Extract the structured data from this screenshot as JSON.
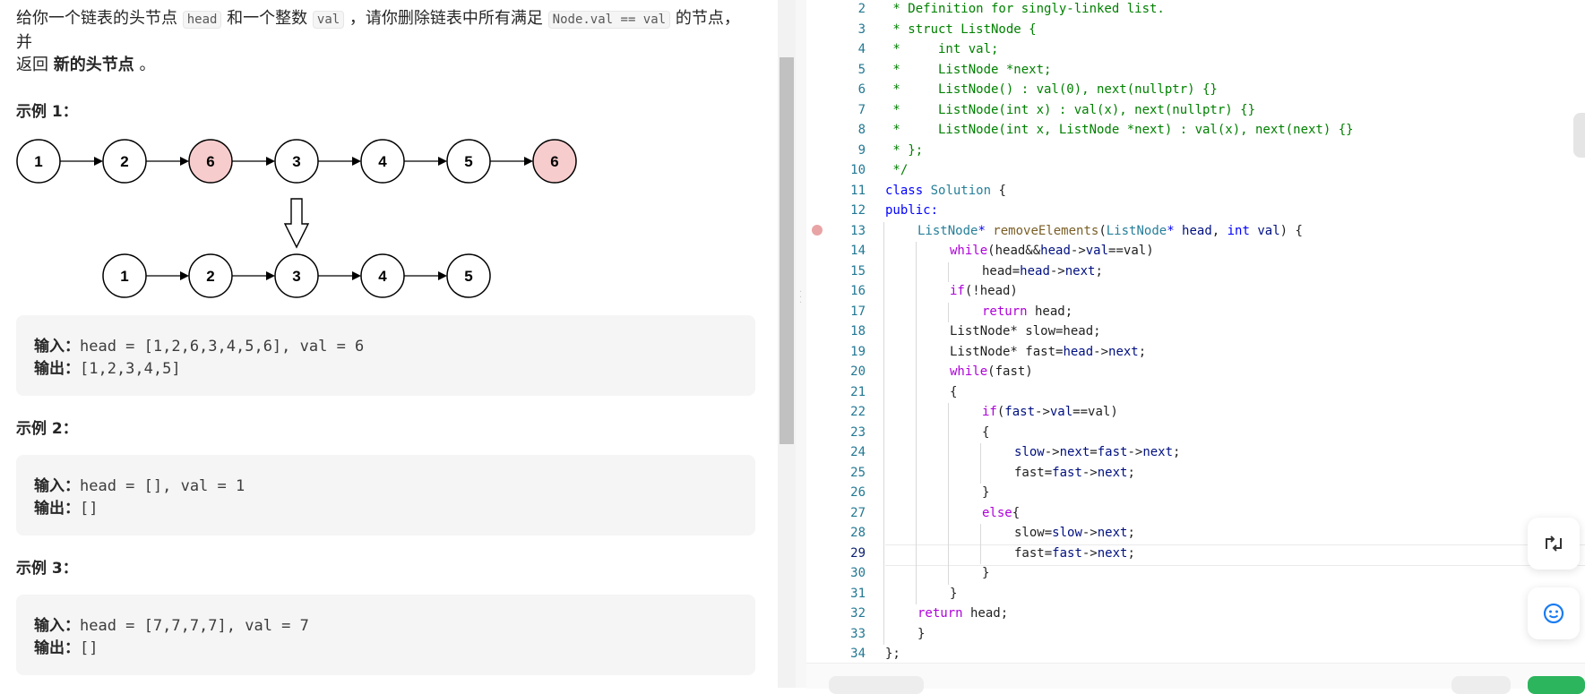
{
  "description": {
    "p1": "给你一个链表的头节点 ",
    "c1": "head",
    "p2": " 和一个整数 ",
    "c2": "val",
    "p3": " ，请你删除链表中所有满足 ",
    "c3": "Node.val == val",
    "p4": " 的节点，并",
    "p5": "返回 ",
    "p6": "新的头节点",
    "p7": " 。"
  },
  "diagram": {
    "top_nodes": [
      "1",
      "2",
      "6",
      "3",
      "4",
      "5",
      "6"
    ],
    "top_removed": [
      false,
      false,
      true,
      false,
      false,
      false,
      true
    ],
    "bottom_nodes": [
      "1",
      "2",
      "3",
      "4",
      "5"
    ]
  },
  "examples": [
    {
      "title": "示例 1：",
      "input_label": "输入：",
      "input": "head = [1,2,6,3,4,5,6], val = 6",
      "output_label": "输出：",
      "output": "[1,2,3,4,5]"
    },
    {
      "title": "示例 2：",
      "input_label": "输入：",
      "input": "head = [], val = 1",
      "output_label": "输出：",
      "output": "[]"
    },
    {
      "title": "示例 3：",
      "input_label": "输入：",
      "input": "head = [7,7,7,7], val = 7",
      "output_label": "输出：",
      "output": "[]"
    }
  ],
  "editor": {
    "lines": [
      {
        "n": "2",
        "indent": 0,
        "tokens": [
          [
            " * Definition for singly-linked list.",
            "cm"
          ]
        ]
      },
      {
        "n": "3",
        "indent": 0,
        "tokens": [
          [
            " * struct ListNode {",
            "cm"
          ]
        ]
      },
      {
        "n": "4",
        "indent": 0,
        "tokens": [
          [
            " *     int val;",
            "cm"
          ]
        ]
      },
      {
        "n": "5",
        "indent": 0,
        "tokens": [
          [
            " *     ListNode *next;",
            "cm"
          ]
        ]
      },
      {
        "n": "6",
        "indent": 0,
        "tokens": [
          [
            " *     ListNode() : val(0), next(nullptr) {}",
            "cm"
          ]
        ]
      },
      {
        "n": "7",
        "indent": 0,
        "tokens": [
          [
            " *     ListNode(int x) : val(x), next(nullptr) {}",
            "cm"
          ]
        ]
      },
      {
        "n": "8",
        "indent": 0,
        "tokens": [
          [
            " *     ListNode(int x, ListNode *next) : val(x), next(next) {}",
            "cm"
          ]
        ]
      },
      {
        "n": "9",
        "indent": 0,
        "tokens": [
          [
            " * };",
            "cm"
          ]
        ]
      },
      {
        "n": "10",
        "indent": 0,
        "tokens": [
          [
            " */",
            "cm"
          ]
        ]
      },
      {
        "n": "11",
        "indent": 0,
        "tokens": [
          [
            "class",
            "kw"
          ],
          [
            " ",
            ""
          ],
          [
            "Solution",
            "ty"
          ],
          [
            " {",
            ""
          ]
        ]
      },
      {
        "n": "12",
        "indent": 0,
        "tokens": [
          [
            "public:",
            "kw"
          ]
        ]
      },
      {
        "n": "13",
        "indent": 1,
        "tokens": [
          [
            "ListNode",
            "ty"
          ],
          [
            "* ",
            "kw"
          ],
          [
            "removeElements",
            "fn"
          ],
          [
            "(",
            ""
          ],
          [
            "ListNode",
            "ty"
          ],
          [
            "* ",
            "kw"
          ],
          [
            "head",
            "var"
          ],
          [
            ", ",
            ""
          ],
          [
            "int",
            "kw"
          ],
          [
            " ",
            ""
          ],
          [
            "val",
            "var"
          ],
          [
            ") {",
            ""
          ]
        ]
      },
      {
        "n": "14",
        "indent": 2,
        "tokens": [
          [
            "while",
            "ctl"
          ],
          [
            "(head&&",
            ""
          ],
          [
            "head",
            "var"
          ],
          [
            "->",
            ""
          ],
          [
            "val",
            "var"
          ],
          [
            "==val)",
            ""
          ]
        ]
      },
      {
        "n": "15",
        "indent": 3,
        "tokens": [
          [
            "head=",
            ""
          ],
          [
            "head",
            "var"
          ],
          [
            "->",
            ""
          ],
          [
            "next",
            "var"
          ],
          [
            ";",
            ""
          ]
        ]
      },
      {
        "n": "16",
        "indent": 2,
        "tokens": [
          [
            "if",
            "ctl"
          ],
          [
            "(!head)",
            ""
          ]
        ]
      },
      {
        "n": "17",
        "indent": 3,
        "tokens": [
          [
            "return",
            "ctl"
          ],
          [
            " head;",
            ""
          ]
        ]
      },
      {
        "n": "18",
        "indent": 2,
        "tokens": [
          [
            "ListNode* slow=head;",
            ""
          ]
        ]
      },
      {
        "n": "19",
        "indent": 2,
        "tokens": [
          [
            "ListNode* fast=",
            ""
          ],
          [
            "head",
            "var"
          ],
          [
            "->",
            ""
          ],
          [
            "next",
            "var"
          ],
          [
            ";",
            ""
          ]
        ]
      },
      {
        "n": "20",
        "indent": 2,
        "tokens": [
          [
            "while",
            "ctl"
          ],
          [
            "(fast)",
            ""
          ]
        ]
      },
      {
        "n": "21",
        "indent": 2,
        "tokens": [
          [
            "{",
            ""
          ]
        ]
      },
      {
        "n": "22",
        "indent": 3,
        "tokens": [
          [
            "if",
            "ctl"
          ],
          [
            "(",
            ""
          ],
          [
            "fast",
            "var"
          ],
          [
            "->",
            ""
          ],
          [
            "val",
            "var"
          ],
          [
            "==val)",
            ""
          ]
        ]
      },
      {
        "n": "23",
        "indent": 3,
        "tokens": [
          [
            "{",
            ""
          ]
        ]
      },
      {
        "n": "24",
        "indent": 4,
        "tokens": [
          [
            "slow",
            "var"
          ],
          [
            "->",
            ""
          ],
          [
            "next",
            "var"
          ],
          [
            "=",
            ""
          ],
          [
            "fast",
            "var"
          ],
          [
            "->",
            ""
          ],
          [
            "next",
            "var"
          ],
          [
            ";",
            ""
          ]
        ]
      },
      {
        "n": "25",
        "indent": 4,
        "tokens": [
          [
            "fast=",
            ""
          ],
          [
            "fast",
            "var"
          ],
          [
            "->",
            ""
          ],
          [
            "next",
            "var"
          ],
          [
            ";",
            ""
          ]
        ]
      },
      {
        "n": "26",
        "indent": 3,
        "tokens": [
          [
            "}",
            ""
          ]
        ]
      },
      {
        "n": "27",
        "indent": 3,
        "tokens": [
          [
            "else",
            "ctl"
          ],
          [
            "{",
            ""
          ]
        ]
      },
      {
        "n": "28",
        "indent": 4,
        "tokens": [
          [
            "slow=",
            ""
          ],
          [
            "slow",
            "var"
          ],
          [
            "->",
            ""
          ],
          [
            "next",
            "var"
          ],
          [
            ";",
            ""
          ]
        ]
      },
      {
        "n": "29",
        "indent": 4,
        "tokens": [
          [
            "fast=",
            ""
          ],
          [
            "fast",
            "var"
          ],
          [
            "->",
            ""
          ],
          [
            "next",
            "var"
          ],
          [
            ";",
            ""
          ]
        ]
      },
      {
        "n": "30",
        "indent": 3,
        "tokens": [
          [
            "}",
            ""
          ]
        ]
      },
      {
        "n": "31",
        "indent": 2,
        "tokens": [
          [
            "}",
            ""
          ]
        ]
      },
      {
        "n": "32",
        "indent": 1,
        "tokens": [
          [
            "return",
            "ctl"
          ],
          [
            " head;",
            ""
          ]
        ]
      },
      {
        "n": "33",
        "indent": 1,
        "tokens": [
          [
            "}",
            ""
          ]
        ]
      },
      {
        "n": "34",
        "indent": 0,
        "tokens": [
          [
            "};",
            ""
          ]
        ]
      }
    ],
    "current_line": "29",
    "breakpoint_line": "13"
  },
  "floating": {
    "reset_icon": "reset-code-icon",
    "chat_icon": "chat-assistant-icon"
  }
}
